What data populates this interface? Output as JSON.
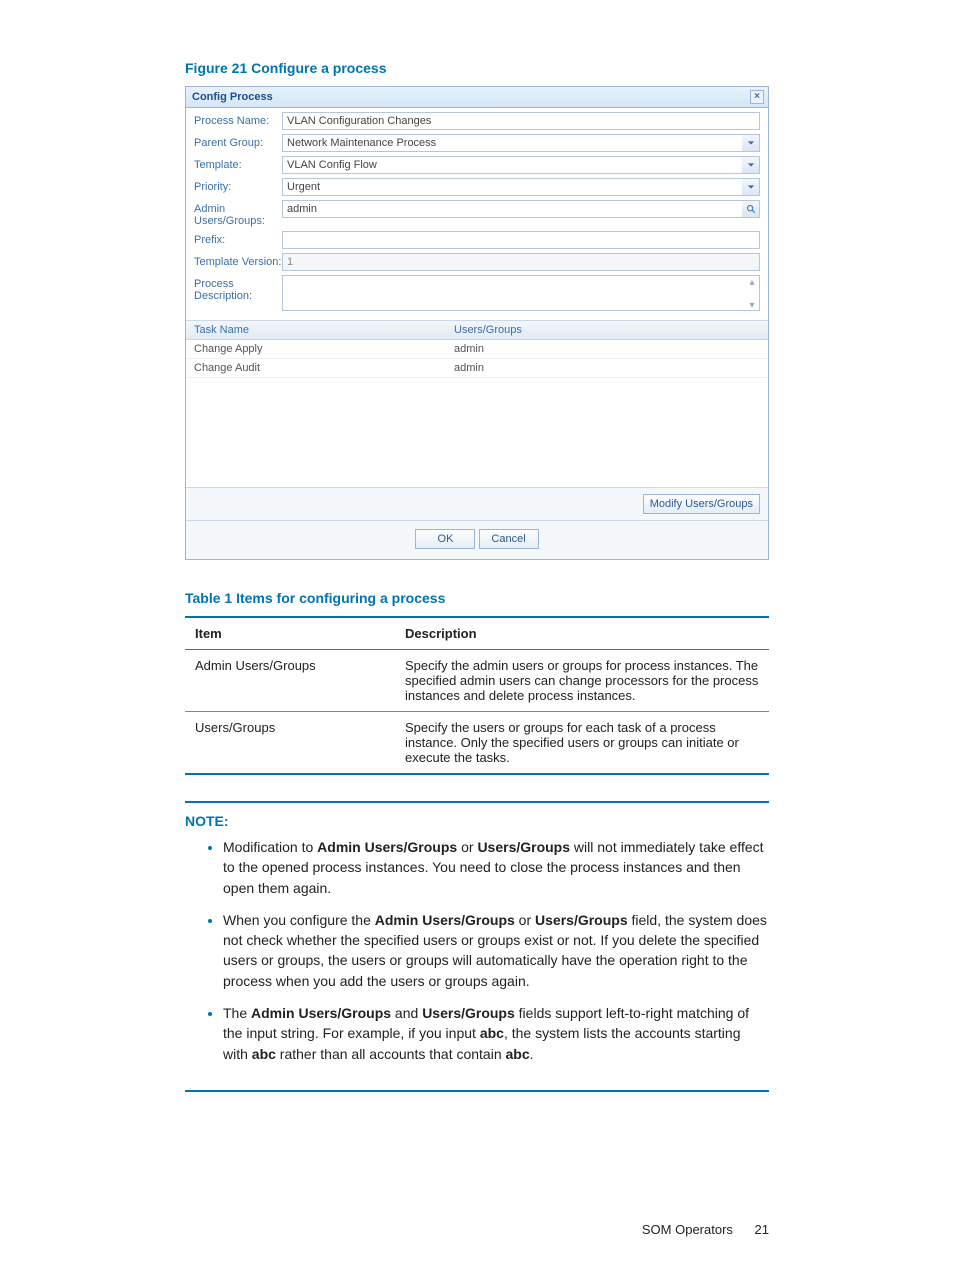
{
  "captions": {
    "figure": "Figure 21 Configure a process",
    "table": "Table 1 Items for configuring a process"
  },
  "dialog": {
    "title": "Config Process",
    "labels": {
      "processName": "Process Name:",
      "parentGroup": "Parent Group:",
      "template": "Template:",
      "priority": "Priority:",
      "adminUG": "Admin Users/Groups:",
      "prefix": "Prefix:",
      "tplVersion": "Template Version:",
      "procDesc": "Process Description:"
    },
    "values": {
      "processName": "VLAN Configuration Changes",
      "parentGroup": "Network Maintenance Process",
      "template": "VLAN Config Flow",
      "priority": "Urgent",
      "adminUG": "admin",
      "prefix": "",
      "tplVersion": "1",
      "procDesc": ""
    },
    "grid": {
      "headers": {
        "task": "Task Name",
        "ug": "Users/Groups"
      },
      "rows": [
        {
          "task": "Change Apply",
          "ug": "admin"
        },
        {
          "task": "Change Audit",
          "ug": "admin"
        }
      ]
    },
    "buttons": {
      "modifyUG": "Modify Users/Groups",
      "ok": "OK",
      "cancel": "Cancel"
    }
  },
  "table1": {
    "headers": {
      "item": "Item",
      "desc": "Description"
    },
    "rows": [
      {
        "item": "Admin Users/Groups",
        "desc": "Specify the admin users or groups for process instances. The specified admin users can change processors for the process instances and delete process instances."
      },
      {
        "item": "Users/Groups",
        "desc": "Specify the users or groups for each task of a process instance. Only the specified users or groups can initiate or execute the tasks."
      }
    ]
  },
  "note": {
    "head": "NOTE:",
    "bold": {
      "adminUG": "Admin Users/Groups",
      "ug": "Users/Groups",
      "abc": "abc"
    },
    "items": {
      "i1a": "Modification to ",
      "i1b": " or ",
      "i1c": " will not immediately take effect to the opened process instances. You need to close the process instances and then open them again.",
      "i2a": "When you configure the ",
      "i2b": " or ",
      "i2c": " field, the system does not check whether the specified users or groups exist or not. If you delete the specified users or groups, the users or groups will automatically have the operation right to the process when you add the users or groups again.",
      "i3a": "The ",
      "i3b": " and ",
      "i3c": " fields support left-to-right matching of the input string. For example, if you input ",
      "i3d": ", the system lists the accounts starting with ",
      "i3e": " rather than all accounts that contain ",
      "i3f": "."
    }
  },
  "footer": {
    "section": "SOM Operators",
    "page": "21"
  }
}
